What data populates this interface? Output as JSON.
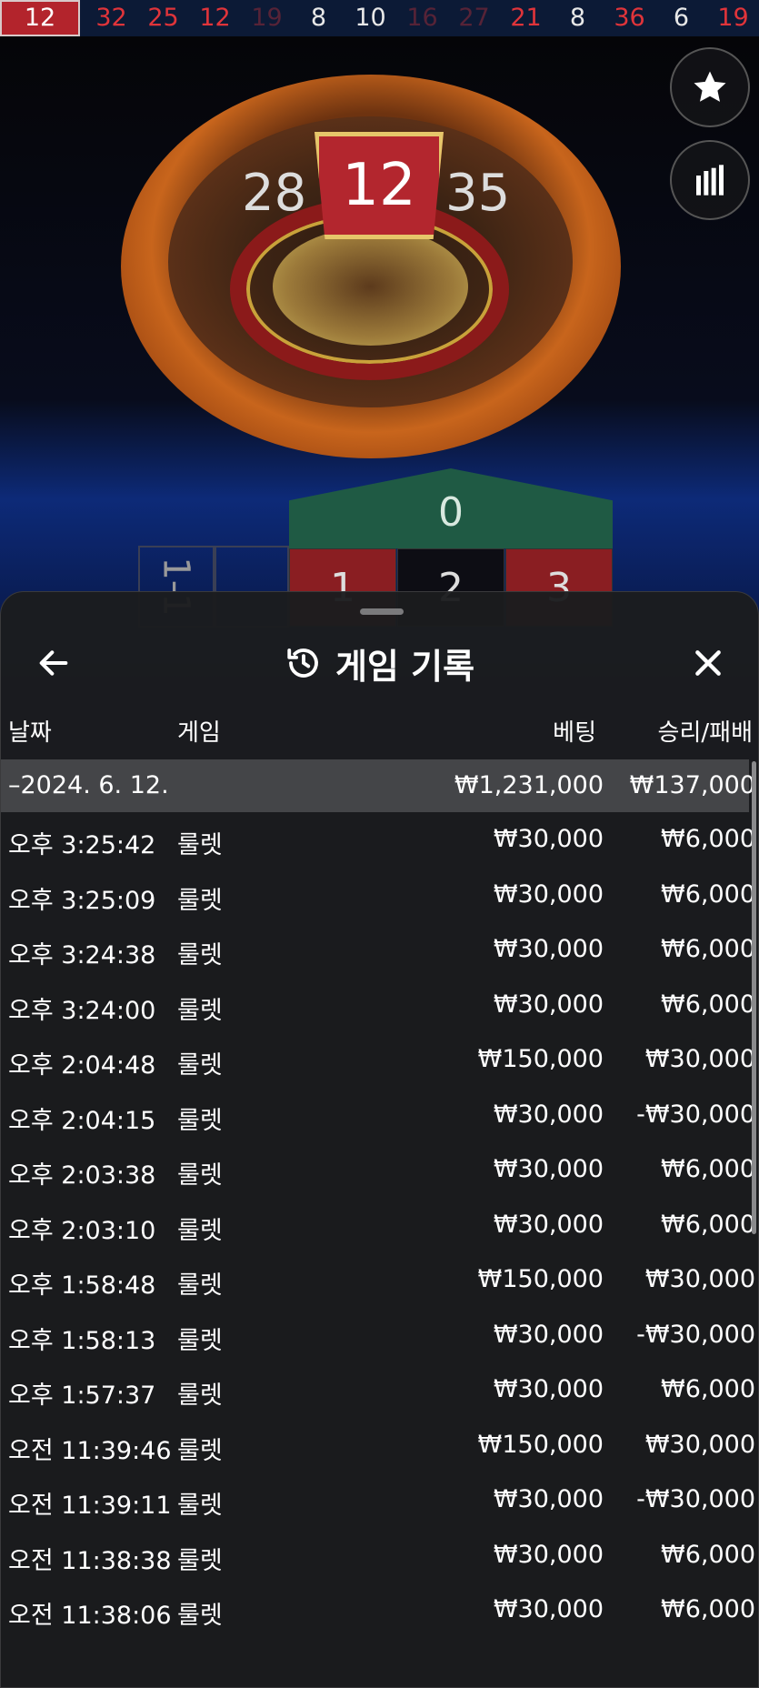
{
  "results_strip": [
    {
      "value": "12",
      "color": "red",
      "latest": true
    },
    {
      "value": "32",
      "color": "red"
    },
    {
      "value": "25",
      "color": "red"
    },
    {
      "value": "12",
      "color": "red"
    },
    {
      "value": "19",
      "color": "red"
    },
    {
      "value": "8",
      "color": "black"
    },
    {
      "value": "10",
      "color": "black"
    },
    {
      "value": "16",
      "color": "red"
    },
    {
      "value": "27",
      "color": "red"
    },
    {
      "value": "21",
      "color": "red"
    },
    {
      "value": "8",
      "color": "black"
    },
    {
      "value": "36",
      "color": "red"
    },
    {
      "value": "6",
      "color": "black"
    },
    {
      "value": "19",
      "color": "red"
    }
  ],
  "wheel": {
    "left_number": "28",
    "winning_number": "12",
    "right_number": "35"
  },
  "board": {
    "zero": "0",
    "cells": [
      "1",
      "2",
      "3"
    ],
    "side_label": "1-1"
  },
  "side_buttons": {
    "favorite_icon": "star-icon",
    "stats_icon": "bar-chart-icon"
  },
  "history": {
    "title": "게임 기록",
    "back_icon": "arrow-left-icon",
    "history_icon": "history-icon",
    "close_icon": "close-icon",
    "columns": {
      "date": "날짜",
      "game": "게임",
      "bet": "베팅",
      "win_loss": "승리/패배"
    },
    "day_summary": {
      "date": "–2024. 6. 12.",
      "bet": "₩1,231,000",
      "win_loss": "₩137,000"
    },
    "rows": [
      {
        "time": "오후 3:25:42",
        "game": "룰렛",
        "bet": "₩30,000",
        "win_loss": "₩6,000"
      },
      {
        "time": "오후 3:25:09",
        "game": "룰렛",
        "bet": "₩30,000",
        "win_loss": "₩6,000"
      },
      {
        "time": "오후 3:24:38",
        "game": "룰렛",
        "bet": "₩30,000",
        "win_loss": "₩6,000"
      },
      {
        "time": "오후 3:24:00",
        "game": "룰렛",
        "bet": "₩30,000",
        "win_loss": "₩6,000"
      },
      {
        "time": "오후 2:04:48",
        "game": "룰렛",
        "bet": "₩150,000",
        "win_loss": "₩30,000"
      },
      {
        "time": "오후 2:04:15",
        "game": "룰렛",
        "bet": "₩30,000",
        "win_loss": "-₩30,000"
      },
      {
        "time": "오후 2:03:38",
        "game": "룰렛",
        "bet": "₩30,000",
        "win_loss": "₩6,000"
      },
      {
        "time": "오후 2:03:10",
        "game": "룰렛",
        "bet": "₩30,000",
        "win_loss": "₩6,000"
      },
      {
        "time": "오후 1:58:48",
        "game": "룰렛",
        "bet": "₩150,000",
        "win_loss": "₩30,000"
      },
      {
        "time": "오후 1:58:13",
        "game": "룰렛",
        "bet": "₩30,000",
        "win_loss": "-₩30,000"
      },
      {
        "time": "오후 1:57:37",
        "game": "룰렛",
        "bet": "₩30,000",
        "win_loss": "₩6,000"
      },
      {
        "time": "오전 11:39:46",
        "game": "룰렛",
        "bet": "₩150,000",
        "win_loss": "₩30,000"
      },
      {
        "time": "오전 11:39:11",
        "game": "룰렛",
        "bet": "₩30,000",
        "win_loss": "-₩30,000"
      },
      {
        "time": "오전 11:38:38",
        "game": "룰렛",
        "bet": "₩30,000",
        "win_loss": "₩6,000"
      },
      {
        "time": "오전 11:38:06",
        "game": "룰렛",
        "bet": "₩30,000",
        "win_loss": "₩6,000"
      }
    ]
  },
  "colors": {
    "red": "#e0343a",
    "sheet_bg": "#1b1c1e",
    "day_row_bg": "#444548",
    "zero_green": "#1f5a44"
  }
}
